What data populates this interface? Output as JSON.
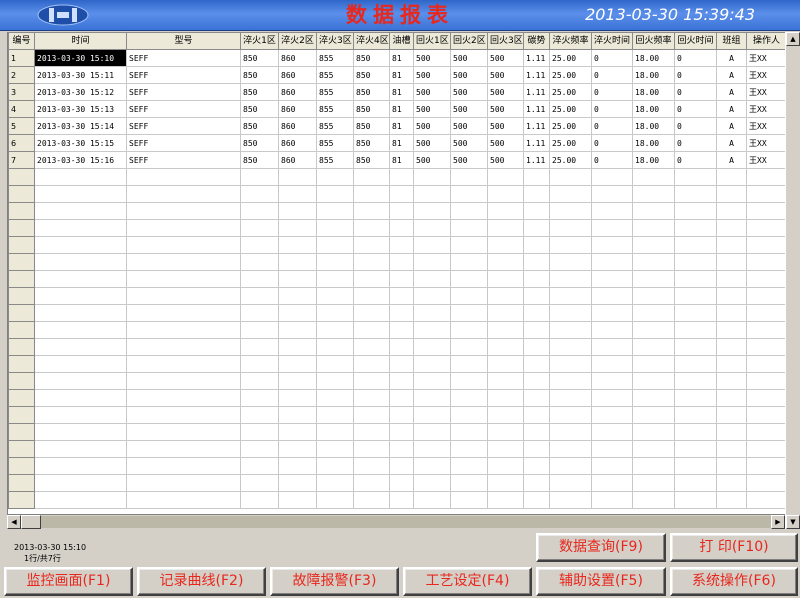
{
  "header": {
    "title": "数据报表",
    "datetime": "2013-03-30 15:39:43"
  },
  "table": {
    "columns": [
      "编号",
      "时间",
      "型号",
      "淬火1区",
      "淬火2区",
      "淬火3区",
      "淬火4区",
      "油槽",
      "回火1区",
      "回火2区",
      "回火3区",
      "碳势",
      "淬火频率",
      "淬火时间",
      "回火频率",
      "回火时间",
      "班组",
      "操作人"
    ],
    "rows": [
      [
        "1",
        "2013-03-30 15:10",
        "SEFF",
        "850",
        "860",
        "855",
        "850",
        "81",
        "500",
        "500",
        "500",
        "1.11",
        "25.00",
        "0",
        "18.00",
        "0",
        "A",
        "王XX"
      ],
      [
        "2",
        "2013-03-30 15:11",
        "SEFF",
        "850",
        "860",
        "855",
        "850",
        "81",
        "500",
        "500",
        "500",
        "1.11",
        "25.00",
        "0",
        "18.00",
        "0",
        "A",
        "王XX"
      ],
      [
        "3",
        "2013-03-30 15:12",
        "SEFF",
        "850",
        "860",
        "855",
        "850",
        "81",
        "500",
        "500",
        "500",
        "1.11",
        "25.00",
        "0",
        "18.00",
        "0",
        "A",
        "王XX"
      ],
      [
        "4",
        "2013-03-30 15:13",
        "SEFF",
        "850",
        "860",
        "855",
        "850",
        "81",
        "500",
        "500",
        "500",
        "1.11",
        "25.00",
        "0",
        "18.00",
        "0",
        "A",
        "王XX"
      ],
      [
        "5",
        "2013-03-30 15:14",
        "SEFF",
        "850",
        "860",
        "855",
        "850",
        "81",
        "500",
        "500",
        "500",
        "1.11",
        "25.00",
        "0",
        "18.00",
        "0",
        "A",
        "王XX"
      ],
      [
        "6",
        "2013-03-30 15:15",
        "SEFF",
        "850",
        "860",
        "855",
        "850",
        "81",
        "500",
        "500",
        "500",
        "1.11",
        "25.00",
        "0",
        "18.00",
        "0",
        "A",
        "王XX"
      ],
      [
        "7",
        "2013-03-30 15:16",
        "SEFF",
        "850",
        "860",
        "855",
        "850",
        "81",
        "500",
        "500",
        "500",
        "1.11",
        "25.00",
        "0",
        "18.00",
        "0",
        "A",
        "王XX"
      ]
    ]
  },
  "status": {
    "selected_time": "2013-03-30 15:10",
    "row_info": "1行/共7行"
  },
  "actions": {
    "query": "数据查询(F9)",
    "print": "打 印(F10)"
  },
  "nav": [
    {
      "label": "监控画面(F1)"
    },
    {
      "label": "记录曲线(F2)"
    },
    {
      "label": "故障报警(F3)"
    },
    {
      "label": "工艺设定(F4)"
    },
    {
      "label": "辅助设置(F5)"
    },
    {
      "label": "系统操作(F6)"
    }
  ],
  "colors": {
    "title_red": "#e8271d",
    "titlebar_blue": "#3a72d6",
    "panel_gray": "#d4d0c8"
  }
}
